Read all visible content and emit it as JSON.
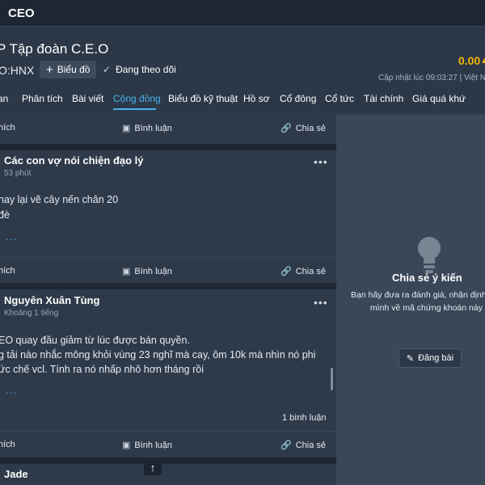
{
  "app": {
    "title": "CEO"
  },
  "header": {
    "company_name": "P Tập đoàn C.E.O",
    "ticker": "O:HNX",
    "chart_button": "Biểu đồ",
    "follow_label": "Đang theo dõi",
    "price": "0.00",
    "update_label": "Cập nhật lúc  09:03:27 | Việt Nam"
  },
  "tabs": [
    "an",
    "Phân tích",
    "Bài viết",
    "Cộng đồng",
    "Biểu đồ kỹ thuật",
    "Hồ sơ",
    "Cổ đông",
    "Cổ tức",
    "Tài chính",
    "Giá quá khứ"
  ],
  "active_tab": "Cộng đồng",
  "actions": {
    "like": "hích",
    "comment": "Bình luận",
    "share": "Chia sẻ"
  },
  "posts": [
    {
      "author": "Các con vợ nói chiện đạo lý",
      "time": "53 phút",
      "lines": [
        "nay lại vẽ cây nến chân 20",
        "đè"
      ],
      "more": "..."
    },
    {
      "author": "Nguyên Xuân Tùng",
      "time": "Khoảng 1 tiếng",
      "lines": [
        "EO quay đầu giảm từ lúc được bán quyền.",
        "g tải nào nhắc mông khỏi vùng 23 nghĩ mà cay, ôm 10k mà nhìn nó phi",
        "ức chế vcl. Tính ra nó nhấp nhô hơn tháng rồi"
      ],
      "more": "...",
      "comment_count": "1 bình luận"
    },
    {
      "author": "Jade"
    }
  ],
  "sidebar": {
    "title": "Chia sẻ ý kiến",
    "desc_line1": "Bạn hãy đưa ra đánh giá, nhận định",
    "desc_line2": "mình về mã chứng khoán này",
    "post_button": "Đăng bài"
  },
  "colors": {
    "accent": "#4ab1ee",
    "price": "#f2b600",
    "background": "#2e3a4a",
    "sidebar": "#3a4758"
  }
}
